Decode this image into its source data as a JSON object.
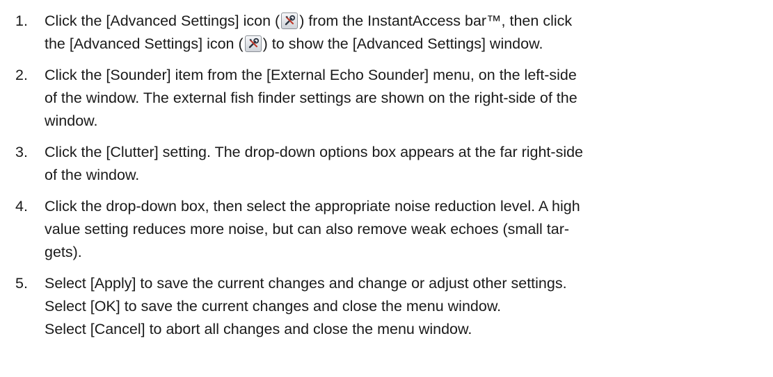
{
  "icons": {
    "advanced_settings": "wrench-screwdriver-icon"
  },
  "steps": [
    {
      "number": "1.",
      "lines": [
        {
          "before": "Click the [Advanced Settings] icon (",
          "after": ") from the InstantAccess bar™, then click"
        },
        {
          "before": "the [Advanced Settings] icon (",
          "after": ") to show the [Advanced Settings] window."
        }
      ]
    },
    {
      "number": "2.",
      "lines": [
        "Click the [Sounder] item from the [External Echo Sounder] menu, on the left-side",
        "of the window. The external fish finder settings are shown on the right-side of the",
        "window."
      ]
    },
    {
      "number": "3.",
      "lines": [
        "Click the [Clutter] setting. The drop-down options box appears at the far right-side",
        "of the window."
      ]
    },
    {
      "number": "4.",
      "lines": [
        "Click the drop-down box, then select the appropriate noise reduction level. A high",
        "value setting reduces more noise, but can also remove weak echoes (small tar-",
        "gets)."
      ]
    },
    {
      "number": "5.",
      "lines": [
        "Select [Apply] to save the current changes and change or adjust other settings.",
        "Select [OK] to save the current changes and close the menu window.",
        "Select [Cancel] to abort all changes and close the menu window."
      ]
    }
  ]
}
